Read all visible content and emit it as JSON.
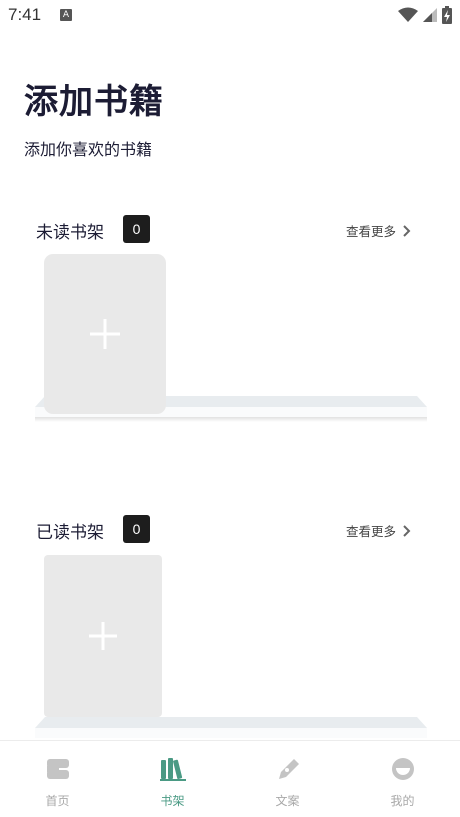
{
  "status_bar": {
    "time": "7:41",
    "notification_badge": "A",
    "icons": [
      "wifi-icon",
      "signal-icon",
      "battery-charging-icon"
    ]
  },
  "header": {
    "title": "添加书籍",
    "subtitle": "添加你喜欢的书籍"
  },
  "shelves": [
    {
      "title": "未读书架",
      "count": "0",
      "more_label": "查看更多"
    },
    {
      "title": "已读书架",
      "count": "0",
      "more_label": "查看更多"
    }
  ],
  "bottom_nav": {
    "items": [
      {
        "label": "首页",
        "icon": "home-icon",
        "active": false
      },
      {
        "label": "书架",
        "icon": "bookshelf-icon",
        "active": true
      },
      {
        "label": "文案",
        "icon": "pen-icon",
        "active": false
      },
      {
        "label": "我的",
        "icon": "profile-icon",
        "active": false
      }
    ]
  },
  "colors": {
    "title": "#1c1c34",
    "badge_bg": "#1d1d1d",
    "book_slot": "#e9e9e9",
    "shelf_board": "#e8ecef",
    "nav_active": "#4a9a84",
    "nav_inactive": "#c4c4c4"
  }
}
